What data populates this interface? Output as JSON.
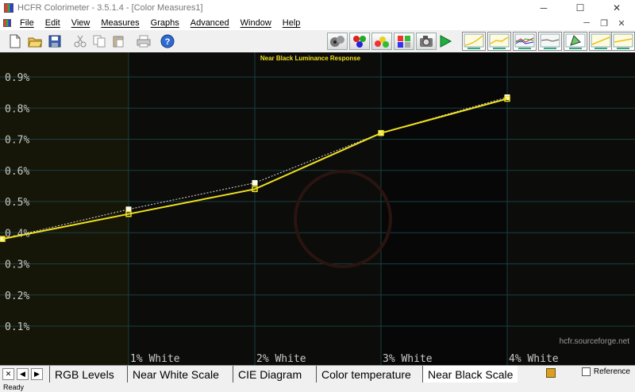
{
  "window": {
    "title": "HCFR Colorimeter - 3.5.1.4 - [Color Measures1]",
    "minimize": "─",
    "maximize": "☐",
    "close": "✕"
  },
  "menu": {
    "items": [
      "File",
      "Edit",
      "View",
      "Measures",
      "Graphs",
      "Advanced",
      "Window",
      "Help"
    ],
    "mdi_minimize": "─",
    "mdi_restore": "❐",
    "mdi_close": "✕"
  },
  "toolbar": {
    "left_icons": [
      "new-file-icon",
      "open-folder-icon",
      "save-icon",
      "cut-icon",
      "copy-icon",
      "paste-icon",
      "print-icon",
      "help-icon"
    ],
    "measure_icons": [
      "sensor-icon",
      "rgb-dots-icon",
      "color-balls-icon",
      "palette-icon",
      "camera-icon",
      "play-icon"
    ],
    "graph_icons": [
      "luminance-graph-icon",
      "gamma-graph-icon",
      "rgb-levels-graph-icon",
      "color-temp-graph-icon",
      "near-black-graph-icon",
      "cie-graph-icon",
      "near-white-graph-icon",
      "saturation-graph-icon"
    ]
  },
  "chart_data": {
    "type": "line",
    "title": "Near Black Luminance Response",
    "x": [
      0,
      1,
      2,
      3,
      4
    ],
    "xlabel": "",
    "ylabel": "",
    "xlim": [
      0,
      5
    ],
    "ylim": [
      0,
      1.0
    ],
    "x_tick_labels": [
      "1% White",
      "2% White",
      "3% White",
      "4% White"
    ],
    "y_tick_labels": [
      "0.1%",
      "0.2%",
      "0.3%",
      "0.4%",
      "0.5%",
      "0.6%",
      "0.7%",
      "0.8%",
      "0.9%"
    ],
    "y_ticks": [
      0.1,
      0.2,
      0.3,
      0.4,
      0.5,
      0.6,
      0.7,
      0.8,
      0.9
    ],
    "series": [
      {
        "values": [
          0.38,
          0.46,
          0.54,
          0.72,
          0.83
        ],
        "color": "#f0e020",
        "style": "solid",
        "markers": "square-outline"
      },
      {
        "values": [
          0.38,
          0.475,
          0.56,
          0.72,
          0.835
        ],
        "color": "#d8d8d8",
        "style": "dotted",
        "markers": "square-filled"
      }
    ],
    "grid": true,
    "watermark_text": "hcfr.sourceforge.net",
    "background": "#0c0c0a",
    "grid_color": "#174040",
    "label_color": "#c8c8c8",
    "title_color": "#f0e020"
  },
  "tabs": {
    "close_btn": "✕",
    "prev_btn": "◀",
    "next_btn": "▶",
    "items": [
      "RGB Levels",
      "Near White Scale",
      "CIE Diagram",
      "Color temperature",
      "Near Black Scale"
    ],
    "active": "Near Black Scale",
    "reference_label": "Reference"
  },
  "status": {
    "text": "Ready"
  }
}
